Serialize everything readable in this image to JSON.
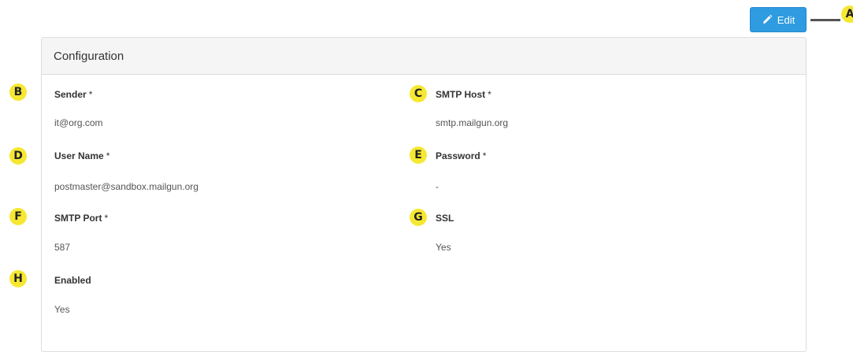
{
  "toolbar": {
    "edit_label": "Edit",
    "edit_icon": "pencil-icon",
    "accent_color": "#2f9be0"
  },
  "markers": {
    "a": "A",
    "b": "B",
    "c": "C",
    "d": "D",
    "e": "E",
    "f": "F",
    "g": "G",
    "h": "H",
    "color": "#f6e832"
  },
  "panel": {
    "title": "Configuration",
    "required_mark": "*",
    "fields": {
      "sender": {
        "label": "Sender",
        "value": "it@org.com"
      },
      "smtp_host": {
        "label": "SMTP Host",
        "value": "smtp.mailgun.org"
      },
      "user_name": {
        "label": "User Name",
        "value": "postmaster@sandbox.mailgun.org"
      },
      "password": {
        "label": "Password",
        "value": "-"
      },
      "smtp_port": {
        "label": "SMTP Port",
        "value": "587"
      },
      "ssl": {
        "label": "SSL",
        "value": "Yes"
      },
      "enabled": {
        "label": "Enabled",
        "value": "Yes"
      }
    }
  }
}
